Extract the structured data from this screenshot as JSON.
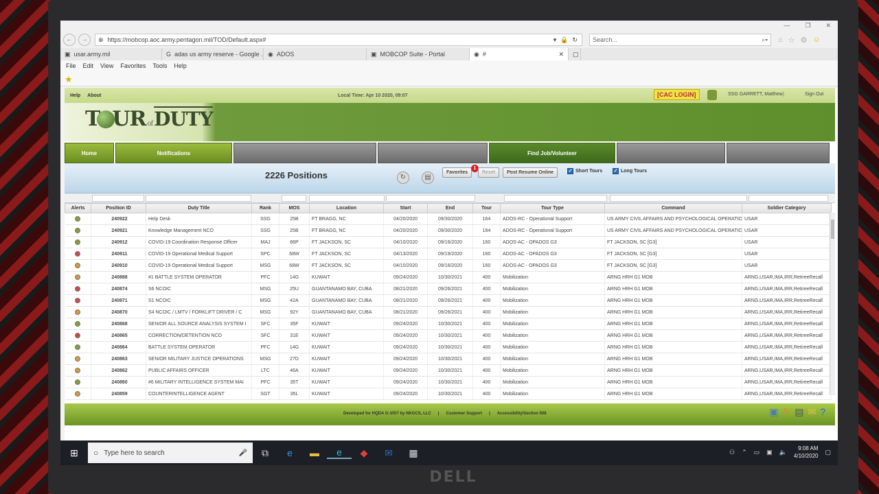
{
  "browser": {
    "url": "https://mobcop.aoc.army.pentagon.mil/TOD/Default.aspx#",
    "search_placeholder": "Search...",
    "tabs": [
      {
        "label": "usar.army.mil"
      },
      {
        "label": "adas us army reserve - Google ..."
      },
      {
        "label": "ADOS"
      },
      {
        "label": "MOBCOP Suite - Portal"
      },
      {
        "label": "#"
      }
    ],
    "menu": [
      "File",
      "Edit",
      "View",
      "Favorites",
      "Tools",
      "Help"
    ]
  },
  "header": {
    "help": "Help",
    "about": "About",
    "local_time": "Local Time: Apr 10 2020, 09:07",
    "cac_login": "[CAC LOGIN]",
    "user": "SSG GARRETT, Matthew",
    "divider": "|",
    "sign_out": "Sign Out"
  },
  "logo": {
    "t": "T",
    "our": "UR",
    "of": "of",
    "duty": "DUTY"
  },
  "nav": {
    "home": "Home",
    "notifications": "Notifications",
    "find_job": "Find Job/Volunteer"
  },
  "toolbar": {
    "positions": "2226 Positions",
    "favorites": "Favorites",
    "favorites_badge": "1",
    "reset": "Reset",
    "post_resume": "Post Resume Online",
    "short_tours": "Short Tours",
    "long_tours": "Long Tours"
  },
  "table": {
    "headers": [
      "Alerts",
      "Position ID",
      "Duty Title",
      "Rank",
      "MOS",
      "Location",
      "Start",
      "End",
      "Tour",
      "Tour Type",
      "Command",
      "Soldier Category"
    ],
    "rows": [
      {
        "alert": "#8a9a3a",
        "id": "240922",
        "title": "Help Desk",
        "rank": "SSG",
        "mos": "25B",
        "loc": "FT BRAGG, NC",
        "start": "04/20/2020",
        "end": "09/30/2020",
        "tour": "164",
        "type": "ADOS-RC - Operational Support",
        "cmd": "US ARMY CIVIL AFFAIRS AND PSYCHOLOGICAL OPERATIO",
        "cat": "USAR"
      },
      {
        "alert": "#8a9a3a",
        "id": "240921",
        "title": "Knowledge Management NCO",
        "rank": "SSG",
        "mos": "25B",
        "loc": "FT BRAGG, NC",
        "start": "04/20/2020",
        "end": "09/30/2020",
        "tour": "164",
        "type": "ADOS-RC - Operational Support",
        "cmd": "US ARMY CIVIL AFFAIRS AND PSYCHOLOGICAL OPERATIO",
        "cat": "USAR"
      },
      {
        "alert": "#8a9a3a",
        "id": "240912",
        "title": "COVID-19 Coordination Response Officer",
        "rank": "MAJ",
        "mos": "66P",
        "loc": "FT JACKSON, SC",
        "start": "04/10/2020",
        "end": "09/16/2020",
        "tour": "160",
        "type": "ADOS-AC - OPADOS G3",
        "cmd": "FT JACKSON, SC [G3]",
        "cat": "USAR"
      },
      {
        "alert": "#c8484a",
        "id": "240911",
        "title": "COVID-19 Operational Medical Support",
        "rank": "SPC",
        "mos": "68W",
        "loc": "FT JACKSON, SC",
        "start": "04/13/2020",
        "end": "09/19/2020",
        "tour": "160",
        "type": "ADOS-AC - OPADOS G3",
        "cmd": "FT JACKSON, SC [G3]",
        "cat": "USAR"
      },
      {
        "alert": "#d89a3a",
        "id": "240910",
        "title": "COVID-19 Operational Medical Support",
        "rank": "MSG",
        "mos": "68W",
        "loc": "FT JACKSON, SC",
        "start": "04/10/2020",
        "end": "09/16/2020",
        "tour": "160",
        "type": "ADOS-AC - OPADOS G3",
        "cmd": "FT JACKSON, SC [G3]",
        "cat": "USAR"
      },
      {
        "alert": "#d89a3a",
        "id": "240888",
        "title": "#1 BATTLE SYSTEM OPERATOR",
        "rank": "PFC",
        "mos": "14G",
        "loc": "KUWAIT",
        "start": "09/24/2020",
        "end": "10/30/2021",
        "tour": "400",
        "type": "Mobilization",
        "cmd": "ARNG HRH G1 MOB",
        "cat": "ARNG,USAR,IMA,IRR,RetireeRecall"
      },
      {
        "alert": "#c8484a",
        "id": "240874",
        "title": "S6 NCOIC",
        "rank": "MSG",
        "mos": "25U",
        "loc": "GUANTANAMO BAY, CUBA",
        "start": "08/21/2020",
        "end": "09/26/2021",
        "tour": "400",
        "type": "Mobilization",
        "cmd": "ARNG HRH G1 MOB",
        "cat": "ARNG,USAR,IMA,IRR,RetireeRecall"
      },
      {
        "alert": "#c8484a",
        "id": "240871",
        "title": "S1 NCOIC",
        "rank": "MSG",
        "mos": "42A",
        "loc": "GUANTANAMO BAY, CUBA",
        "start": "08/21/2020",
        "end": "09/26/2021",
        "tour": "400",
        "type": "Mobilization",
        "cmd": "ARNG HRH G1 MOB",
        "cat": "ARNG,USAR,IMA,IRR,RetireeRecall"
      },
      {
        "alert": "#d89a3a",
        "id": "240870",
        "title": "S4 NCOIC  / LMTV / FORKLIFT DRIVER / C",
        "rank": "MSG",
        "mos": "92Y",
        "loc": "GUANTANAMO BAY, CUBA",
        "start": "08/21/2020",
        "end": "09/26/2021",
        "tour": "400",
        "type": "Mobilization",
        "cmd": "ARNG HRH G1 MOB",
        "cat": "ARNG,USAR,IMA,IRR,RetireeRecall"
      },
      {
        "alert": "#8a9a3a",
        "id": "240868",
        "title": "SENIOR ALL SOURCE ANALYSIS SYSTEM I",
        "rank": "SFC",
        "mos": "35F",
        "loc": "KUWAIT",
        "start": "09/24/2020",
        "end": "10/30/2021",
        "tour": "400",
        "type": "Mobilization",
        "cmd": "ARNG HRH G1 MOB",
        "cat": "ARNG,USAR,IMA,IRR,RetireeRecall"
      },
      {
        "alert": "#c8484a",
        "id": "240865",
        "title": "CORRECTION/DETENTION NCO",
        "rank": "SFC",
        "mos": "31E",
        "loc": "KUWAIT",
        "start": "09/24/2020",
        "end": "10/30/2021",
        "tour": "400",
        "type": "Mobilization",
        "cmd": "ARNG HRH G1 MOB",
        "cat": "ARNG,USAR,IMA,IRR,RetireeRecall"
      },
      {
        "alert": "#8a9a3a",
        "id": "240864",
        "title": "BATTLE SYSTEM OPERATOR",
        "rank": "PFC",
        "mos": "14G",
        "loc": "KUWAIT",
        "start": "09/24/2020",
        "end": "10/30/2021",
        "tour": "400",
        "type": "Mobilization",
        "cmd": "ARNG HRH G1 MOB",
        "cat": "ARNG,USAR,IMA,IRR,RetireeRecall"
      },
      {
        "alert": "#d89a3a",
        "id": "240863",
        "title": "SENIOR MILITARY JUSTICE OPERATIONS",
        "rank": "MSG",
        "mos": "27D",
        "loc": "KUWAIT",
        "start": "09/24/2020",
        "end": "10/30/2021",
        "tour": "400",
        "type": "Mobilization",
        "cmd": "ARNG HRH G1 MOB",
        "cat": "ARNG,USAR,IMA,IRR,RetireeRecall"
      },
      {
        "alert": "#d89a3a",
        "id": "240862",
        "title": "PUBLIC AFFAIRS OFFICER",
        "rank": "LTC",
        "mos": "46A",
        "loc": "KUWAIT",
        "start": "09/24/2020",
        "end": "10/30/2021",
        "tour": "400",
        "type": "Mobilization",
        "cmd": "ARNG HRH G1 MOB",
        "cat": "ARNG,USAR,IMA,IRR,RetireeRecall"
      },
      {
        "alert": "#8a9a3a",
        "id": "240860",
        "title": "#6 MILITARY INTELLIGENCE SYSTEM MAI",
        "rank": "PFC",
        "mos": "35T",
        "loc": "KUWAIT",
        "start": "09/24/2020",
        "end": "10/30/2021",
        "tour": "400",
        "type": "Mobilization",
        "cmd": "ARNG HRH G1 MOB",
        "cat": "ARNG,USAR,IMA,IRR,RetireeRecall"
      },
      {
        "alert": "#d89a3a",
        "id": "240859",
        "title": "COUNTERINTELLIGENCE AGENT",
        "rank": "SGT",
        "mos": "35L",
        "loc": "KUWAIT",
        "start": "09/24/2020",
        "end": "10/30/2021",
        "tour": "400",
        "type": "Mobilization",
        "cmd": "ARNG HRH G1 MOB",
        "cat": "ARNG,USAR,IMA,IRR,RetireeRecall"
      }
    ]
  },
  "footer": {
    "developed": "Developed for HQDA G-3/5/7 by NKGCS, LLC",
    "support": "Customer Support",
    "access": "Accessibility/Section 508"
  },
  "taskbar": {
    "search_placeholder": "Type here to search",
    "time": "9:08 AM",
    "date": "4/10/2020"
  }
}
